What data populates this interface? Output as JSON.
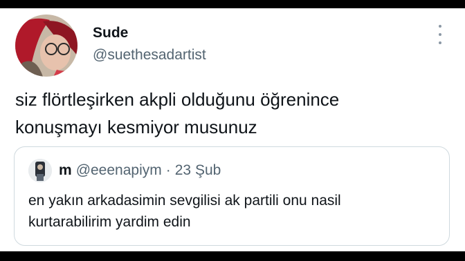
{
  "tweet": {
    "author": {
      "display_name": "Sude",
      "handle": "@suethesadartist"
    },
    "text_lines": [
      "siz flörtleşirken akpli olduğunu öğrenince",
      "konuşmayı kesmiyor musunuz"
    ]
  },
  "quoted_tweet": {
    "author": {
      "display_name": "m",
      "handle": "@eeenapiym"
    },
    "separator": "·",
    "date": "23 Şub",
    "text_lines": [
      "en yakın arkadasimin sevgilisi ak partili onu nasil",
      "kurtarabilirim yardim edin"
    ]
  },
  "icons": {
    "more": "more-vertical-icon"
  },
  "colors": {
    "primary_text": "#0f1419",
    "secondary_text": "#536471",
    "border": "#cfd9de",
    "letterbox": "#000000"
  }
}
